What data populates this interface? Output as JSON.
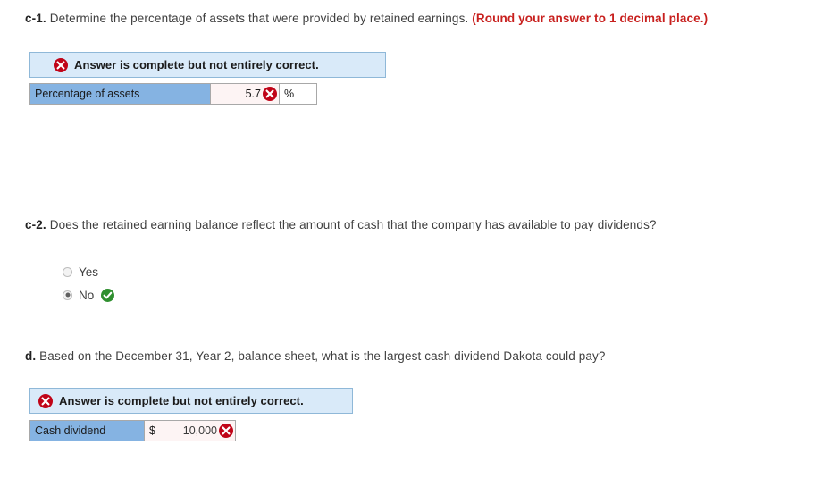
{
  "questions": {
    "c1": {
      "label": "c-1.",
      "text": "Determine the percentage of assets that were provided by retained earnings.",
      "note": "(Round your answer to 1 decimal place.)"
    },
    "c2": {
      "label": "c-2.",
      "text": "Does the retained earning balance reflect the amount of cash that the company has available to pay dividends?"
    },
    "d": {
      "label": "d.",
      "text": "Based on the December 31, Year 2, balance sheet, what is the largest cash dividend Dakota could pay?"
    }
  },
  "banners": {
    "c1": {
      "message": "Answer is complete but not entirely correct.",
      "icon": "error-x-icon"
    },
    "d": {
      "message": "Answer is complete but not entirely correct.",
      "icon": "error-x-icon"
    }
  },
  "answers": {
    "percentage_of_assets": {
      "label": "Percentage of assets",
      "value": "5.7",
      "unit": "%",
      "status": "incorrect",
      "status_icon": "error-x-icon"
    },
    "cash_dividend": {
      "label": "Cash dividend",
      "currency": "$",
      "value": "10,000",
      "status": "incorrect",
      "status_icon": "error-x-icon"
    }
  },
  "radio_options": [
    {
      "label": "Yes",
      "selected": false,
      "status": ""
    },
    {
      "label": "No",
      "selected": true,
      "status": "correct"
    }
  ],
  "colors": {
    "banner_background": "#d9eaf9",
    "banner_border": "#8fb8d8",
    "label_cell": "#85b3e2",
    "value_cell": "#fdf4f4",
    "error_red": "#c00418",
    "note_red": "#c8201e",
    "success_green": "#2f8f2f"
  }
}
